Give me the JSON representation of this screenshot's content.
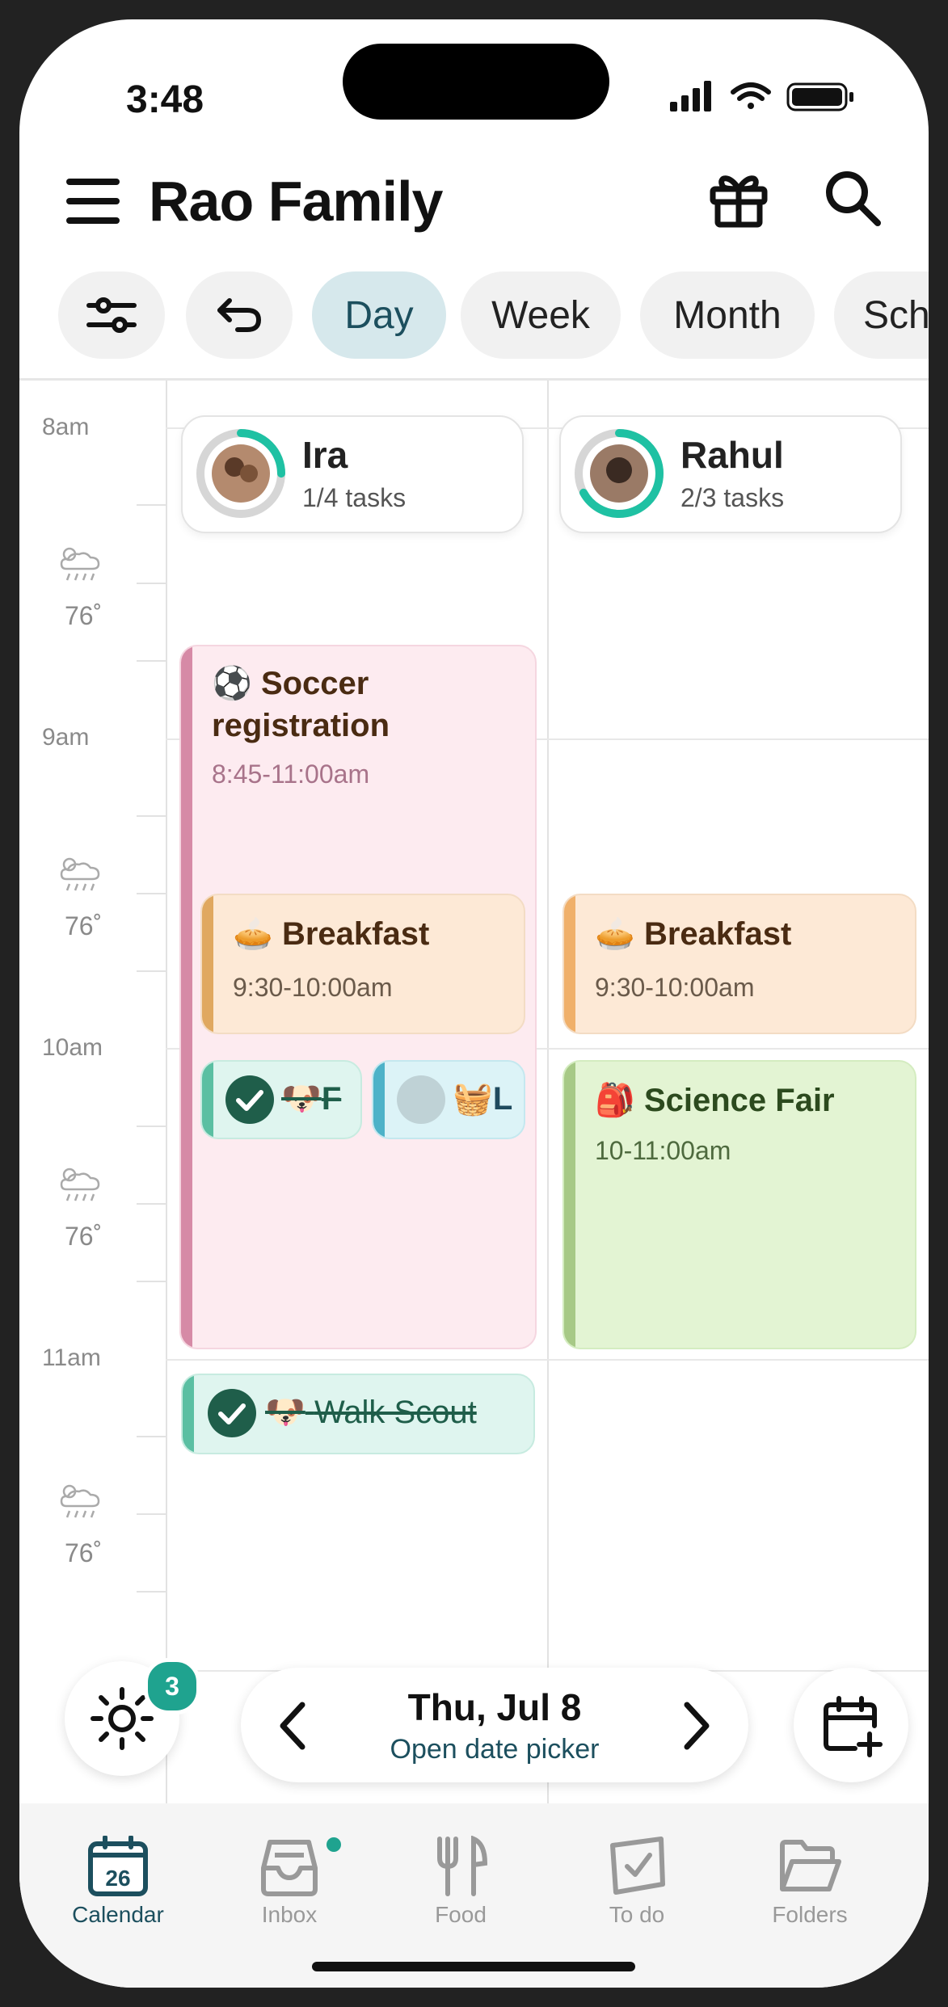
{
  "status_bar": {
    "time": "3:48"
  },
  "header": {
    "title": "Rao Family"
  },
  "filters": {
    "day": "Day",
    "week": "Week",
    "month": "Month",
    "schedule": "Sch"
  },
  "timeline": {
    "hours": [
      "8am",
      "9am",
      "10am",
      "11am"
    ],
    "temps": [
      "76˚",
      "76˚",
      "76˚",
      "76˚"
    ]
  },
  "people": [
    {
      "name": "Ira",
      "tasks": "1/4 tasks",
      "progress": 0.25
    },
    {
      "name": "Rahul",
      "tasks": "2/3 tasks",
      "progress": 0.67
    }
  ],
  "events": {
    "soccer": {
      "emoji": "⚽",
      "title": "Soccer registration",
      "time": "8:45-11:00am",
      "color": "#d68aa6"
    },
    "breakfast_ira": {
      "emoji": "🥧",
      "title": "Breakfast",
      "time": "9:30-10:00am",
      "color": "#e9b06a"
    },
    "breakfast_rahul": {
      "emoji": "🥧",
      "title": "Breakfast",
      "time": "9:30-10:00am",
      "color": "#f0b06a"
    },
    "task_feed": {
      "emoji": "🐶",
      "title": "F"
    },
    "task_laundry": {
      "emoji": "🧺",
      "title": "L"
    },
    "science_fair": {
      "emoji": "🎒",
      "title": "Science Fair",
      "time": "10-11:00am",
      "color": "#a7c986"
    },
    "walk_scout": {
      "emoji": "🐶",
      "title": "Walk Scout"
    }
  },
  "date_nav": {
    "date": "Thu, Jul 8",
    "picker_label": "Open date picker",
    "badge_count": "3"
  },
  "tabbar": {
    "calendar": "Calendar",
    "calendar_day": "26",
    "inbox": "Inbox",
    "food": "Food",
    "todo": "To do",
    "folders": "Folders"
  },
  "colors": {
    "accent": "#1c4f5e",
    "teal": "#1fa38f",
    "day_chip": "#d6e8ec"
  }
}
